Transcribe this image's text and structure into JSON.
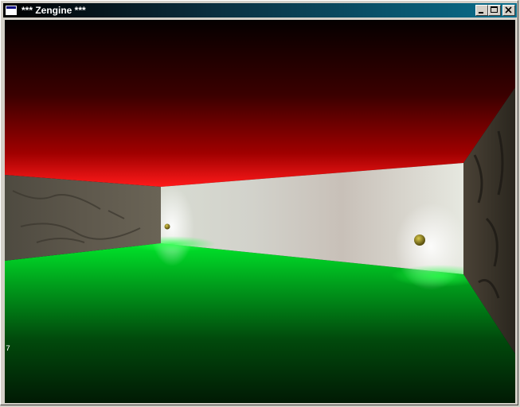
{
  "window": {
    "title": "*** Zengine ***",
    "buttons": {
      "minimize": "minimize",
      "maximize": "maximize",
      "close": "close"
    }
  },
  "scene": {
    "fps_counter": "7",
    "colors": {
      "ceiling": "#ff1a1a",
      "floor": "#00e52a",
      "back_wall": "#e8eae4",
      "stone": "#5c5447",
      "light_orb": "#9a8a1e"
    }
  }
}
